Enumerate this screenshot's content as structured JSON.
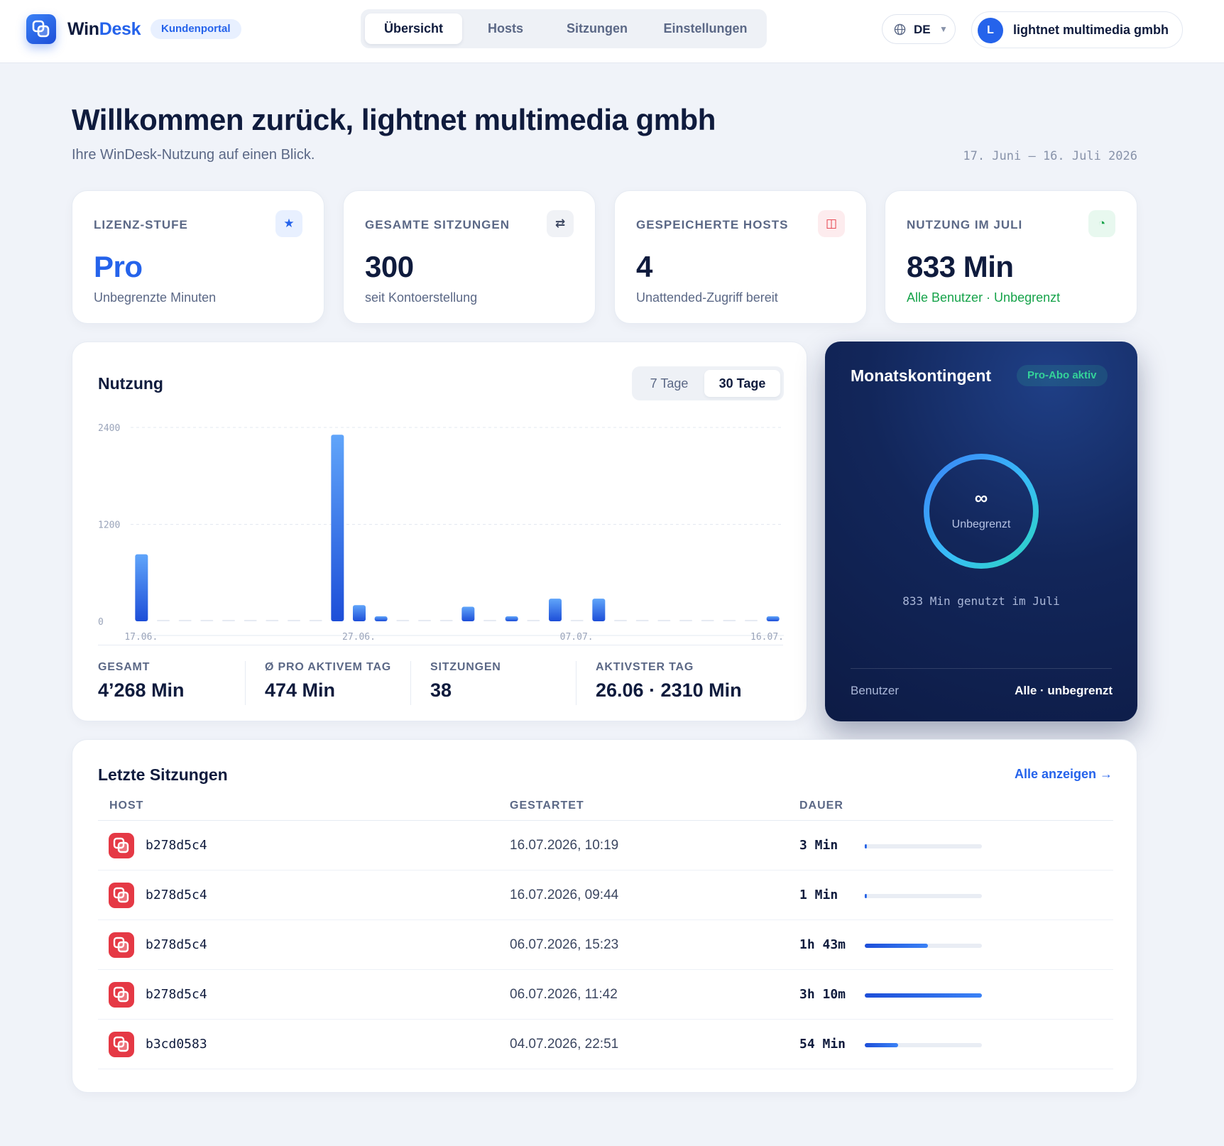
{
  "app": {
    "brand_part1": "Win",
    "brand_part2": "Desk",
    "portal_badge": "Kundenportal",
    "accent_color": "#2563eb"
  },
  "nav": {
    "items": [
      {
        "label": "Übersicht",
        "active": true
      },
      {
        "label": "Hosts",
        "active": false
      },
      {
        "label": "Sitzungen",
        "active": false
      },
      {
        "label": "Einstellungen",
        "active": false
      }
    ]
  },
  "header": {
    "language": "DE",
    "user_initial": "L",
    "user_name": "lightnet multimedia gmbh"
  },
  "page": {
    "title": "Willkommen zurück, lightnet multimedia gmbh",
    "subtitle": "Ihre WinDesk-Nutzung auf einen Blick.",
    "date_range": "17. Juni – 16. Juli 2026"
  },
  "stats": [
    {
      "label": "LIZENZ-STUFE",
      "value": "Pro",
      "note": "Unbegrenzte Minuten",
      "icon": "star-icon",
      "glyph": "★",
      "icon_bg": "#e8f0ff",
      "icon_color": "#2563eb",
      "value_color": "#2563eb",
      "note_color": "#5b6886"
    },
    {
      "label": "GESAMTE SITZUNGEN",
      "value": "300",
      "note": "seit Kontoerstellung",
      "icon": "swap-icon",
      "glyph": "⇄",
      "icon_bg": "#f0f2f6",
      "icon_color": "#3b4660",
      "value_color": "#0f1b3d",
      "note_color": "#5b6886"
    },
    {
      "label": "GESPEICHERTE HOSTS",
      "value": "4",
      "note": "Unattended-Zugriff bereit",
      "icon": "server-icon",
      "glyph": "◫",
      "icon_bg": "#fdecee",
      "icon_color": "#e53945",
      "value_color": "#0f1b3d",
      "note_color": "#5b6886"
    },
    {
      "label": "NUTZUNG IM JULI",
      "value": "833 Min",
      "note": "Alle Benutzer · Unbegrenzt",
      "icon": "pie-chart-icon",
      "glyph": "◔",
      "icon_bg": "#e8f8ef",
      "icon_color": "#16a34a",
      "value_color": "#0f1b3d",
      "note_color": "#16a34a"
    }
  ],
  "usage": {
    "title": "Nutzung",
    "range_options": [
      {
        "label": "7 Tage",
        "active": false
      },
      {
        "label": "30 Tage",
        "active": true
      }
    ],
    "kpis": [
      {
        "label": "GESAMT",
        "value": "4’268 Min"
      },
      {
        "label": "Ø PRO AKTIVEM TAG",
        "value": "474 Min"
      },
      {
        "label": "SITZUNGEN",
        "value": "38"
      },
      {
        "label": "AKTIVSTER TAG",
        "value": "26.06 · 2310 Min"
      }
    ]
  },
  "chart_data": {
    "type": "bar",
    "title": "Nutzung",
    "xlabel": "",
    "ylabel": "",
    "ylim": [
      0,
      2400
    ],
    "yticks": [
      0,
      1200,
      2400
    ],
    "x_tick_labels": [
      "17.06.",
      "27.06.",
      "07.07.",
      "16.07."
    ],
    "x_tick_indices": [
      0,
      10,
      20,
      29
    ],
    "grid": true,
    "values": [
      830,
      0,
      0,
      0,
      0,
      0,
      0,
      0,
      0,
      2310,
      200,
      50,
      0,
      0,
      0,
      180,
      0,
      50,
      0,
      280,
      0,
      280,
      0,
      0,
      0,
      0,
      0,
      0,
      0,
      40
    ]
  },
  "quota": {
    "title": "Monatskontingent",
    "badge": "Pro-Abo aktiv",
    "infinity": "∞",
    "ring_label": "Unbegrenzt",
    "usage_text": "833 Min genutzt im Juli",
    "user_label": "Benutzer",
    "user_value": "Alle · unbegrenzt"
  },
  "sessions": {
    "title": "Letzte Sitzungen",
    "view_all": "Alle anzeigen →",
    "columns": [
      "HOST",
      "GESTARTET",
      "DAUER"
    ],
    "rows": [
      {
        "host": "b278d5c4",
        "started": "16.07.2026, 10:19",
        "duration": "3 Min",
        "fraction": 0.016
      },
      {
        "host": "b278d5c4",
        "started": "16.07.2026, 09:44",
        "duration": "1 Min",
        "fraction": 0.005
      },
      {
        "host": "b278d5c4",
        "started": "06.07.2026, 15:23",
        "duration": "1h 43m",
        "fraction": 0.542
      },
      {
        "host": "b278d5c4",
        "started": "06.07.2026, 11:42",
        "duration": "3h 10m",
        "fraction": 1.0
      },
      {
        "host": "b3cd0583",
        "started": "04.07.2026, 22:51",
        "duration": "54 Min",
        "fraction": 0.284
      }
    ]
  }
}
